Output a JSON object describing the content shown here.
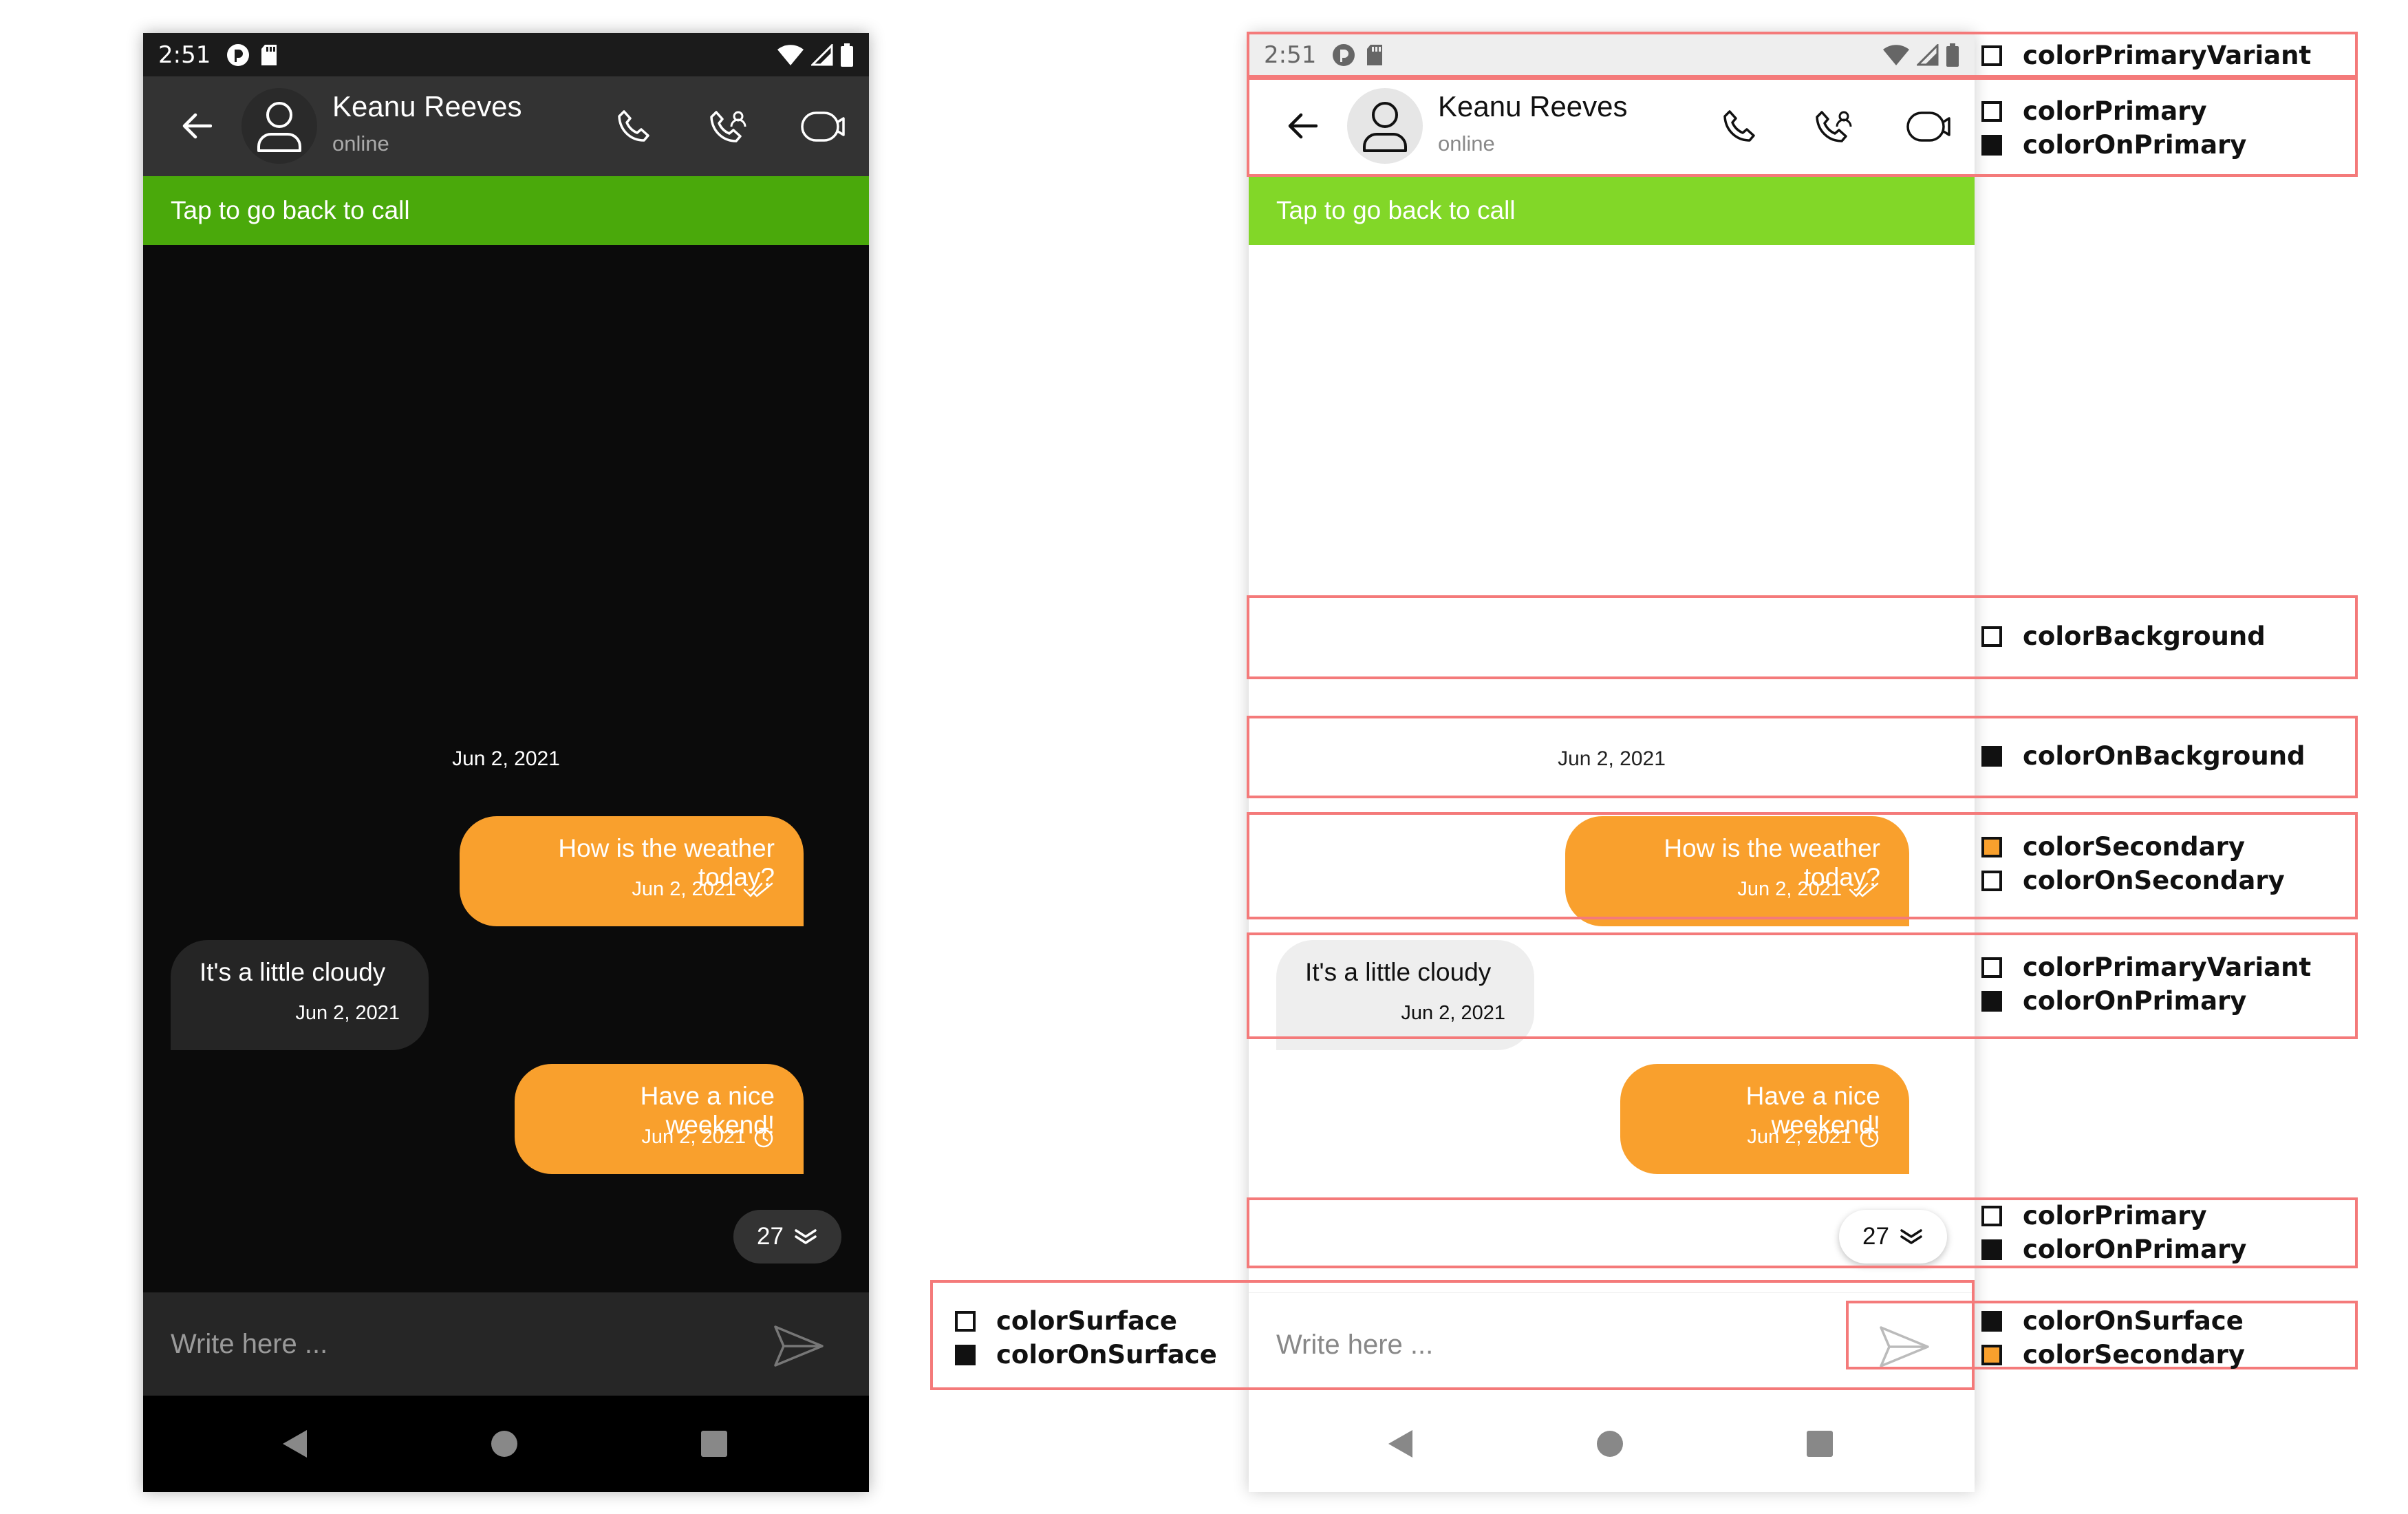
{
  "status_bar": {
    "time": "2:51"
  },
  "app_bar": {
    "contact_name": "Keanu Reeves",
    "contact_status": "online"
  },
  "call_banner": {
    "text": "Tap to go back to call"
  },
  "conversation": {
    "date_separator": "Jun 2, 2021",
    "messages": [
      {
        "direction": "outgoing",
        "text": "How is the weather today?",
        "time": "Jun 2, 2021",
        "status_icon": "double-check-icon"
      },
      {
        "direction": "incoming",
        "text": "It's a little cloudy",
        "time": "Jun 2, 2021"
      },
      {
        "direction": "outgoing",
        "text": "Have a nice weekend!",
        "time": "Jun 2, 2021",
        "status_icon": "pending-clock-icon"
      }
    ],
    "unread_count": "27"
  },
  "composer": {
    "placeholder": "Write here ..."
  },
  "theme_colors": {
    "dark": {
      "status_bar": "#1b1b1b",
      "app_bar": "#333333",
      "call_banner": "#4aa90b",
      "background": "#0b0b0b",
      "incoming_bubble": "#252525",
      "outgoing_bubble": "#f9a02d",
      "composer": "#262626",
      "nav_bar": "#000000"
    },
    "light": {
      "status_bar": "#eeeeee",
      "app_bar": "#ffffff",
      "call_banner": "#82d728",
      "background": "#ffffff",
      "incoming_bubble": "#eeeeee",
      "outgoing_bubble": "#f9a02d",
      "composer": "#ffffff",
      "nav_bar": "#ffffff"
    },
    "annotation_outline": "#f47a7a",
    "swatch_white": "#ffffff",
    "swatch_black": "#111111",
    "swatch_orange": "#f9a02d"
  },
  "annotations": {
    "status_bar": [
      {
        "name": "colorPrimaryVariant",
        "swatch": "white"
      }
    ],
    "app_bar": [
      {
        "name": "colorPrimary",
        "swatch": "white"
      },
      {
        "name": "colorOnPrimary",
        "swatch": "black"
      }
    ],
    "background": [
      {
        "name": "colorBackground",
        "swatch": "white"
      }
    ],
    "date_separator": [
      {
        "name": "colorOnBackground",
        "swatch": "black"
      }
    ],
    "outgoing_bubble": [
      {
        "name": "colorSecondary",
        "swatch": "orange"
      },
      {
        "name": "colorOnSecondary",
        "swatch": "white"
      }
    ],
    "incoming_bubble": [
      {
        "name": "colorPrimaryVariant",
        "swatch": "white"
      },
      {
        "name": "colorOnPrimary",
        "swatch": "black"
      }
    ],
    "scroll_button": [
      {
        "name": "colorPrimary",
        "swatch": "white"
      },
      {
        "name": "colorOnPrimary",
        "swatch": "black"
      }
    ],
    "composer_left": [
      {
        "name": "colorSurface",
        "swatch": "white"
      },
      {
        "name": "colorOnSurface",
        "swatch": "black"
      }
    ],
    "composer_right": [
      {
        "name": "colorOnSurface",
        "swatch": "black"
      },
      {
        "name": "colorSecondary",
        "swatch": "orange"
      }
    ]
  }
}
